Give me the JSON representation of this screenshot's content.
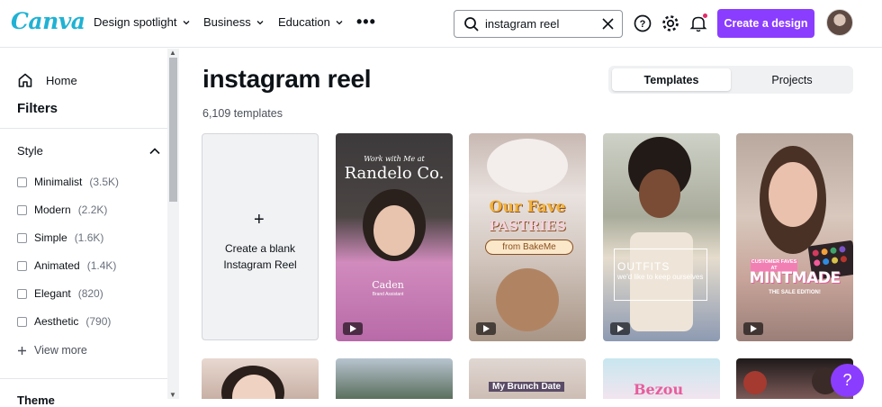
{
  "brand": {
    "logo": "Canva",
    "accent": "#8b3dff",
    "logo_color": "#20b2d4"
  },
  "nav": {
    "items": [
      {
        "label": "Design spotlight"
      },
      {
        "label": "Business"
      },
      {
        "label": "Education"
      }
    ],
    "more_icon": "more-horizontal-icon"
  },
  "search": {
    "value": "instagram reel",
    "placeholder": "Search"
  },
  "actions": {
    "create_label": "Create a design"
  },
  "sidebar": {
    "home_label": "Home",
    "filters_title": "Filters",
    "style_label": "Style",
    "options": [
      {
        "label": "Minimalist",
        "count": "(3.5K)"
      },
      {
        "label": "Modern",
        "count": "(2.2K)"
      },
      {
        "label": "Simple",
        "count": "(1.6K)"
      },
      {
        "label": "Animated",
        "count": "(1.4K)"
      },
      {
        "label": "Elegant",
        "count": "(820)"
      },
      {
        "label": "Aesthetic",
        "count": "(790)"
      }
    ],
    "view_more_label": "View more",
    "next_section_label": "Theme"
  },
  "main": {
    "title": "instagram reel",
    "count_text": "6,109 templates",
    "tabs": [
      {
        "label": "Templates"
      },
      {
        "label": "Projects"
      }
    ],
    "blank_label": "Create a blank\nInstagram Reel",
    "cards": [
      {
        "line1": "Work with Me at",
        "line2": "Randelo Co.",
        "line3": "Caden",
        "line4": "Brand Assistant"
      },
      {
        "line1": "Our Fave",
        "line2": "PASTRIES",
        "line3": "from BakeMe"
      },
      {
        "line1": "OUTFITS",
        "line2": "we'd like to keep ourselves"
      },
      {
        "line1": "CUSTOMER FAVES AT",
        "line2": "MINTMADE",
        "line3": "THE SALE EDITION!"
      }
    ],
    "row2_labels": {
      "c": "My Brunch Date",
      "d": "Bezou"
    }
  },
  "help_label": "?"
}
